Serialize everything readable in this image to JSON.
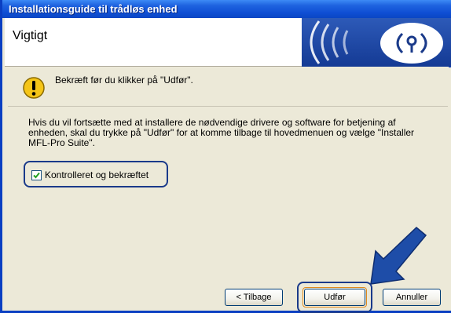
{
  "window": {
    "title": "Installationsguide til trådløs enhed"
  },
  "header": {
    "title": "Vigtigt",
    "banner_icon": "wireless-signal-icon"
  },
  "warning": {
    "icon": "warning-icon",
    "text": "Bekræft før du klikker på \"Udfør\"."
  },
  "body": {
    "line1": "Hvis du vil fortsætte med at installere de nødvendige drivere og software for betjening af",
    "line2": "enheden, skal du trykke på \"Udfør\" for at komme tilbage til hovedmenuen og vælge \"Installer",
    "line3": "MFL-Pro Suite\"."
  },
  "checkbox": {
    "label": "Kontrolleret og bekræftet",
    "checked": true
  },
  "buttons": {
    "back": "< Tilbage",
    "finish": "Udfør",
    "cancel": "Annuller"
  },
  "colors": {
    "titlebar": "#0a46c4",
    "highlight_ring": "#1a3a8a",
    "arrow": "#1e4da8"
  }
}
